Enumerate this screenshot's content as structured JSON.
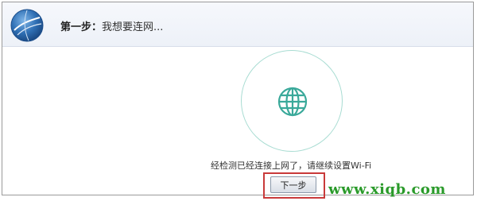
{
  "header": {
    "step_label": "第一步：",
    "step_text": "我想要连网..."
  },
  "status": {
    "message": "经检测已经连接上网了，请继续设置Wi-Fi"
  },
  "actions": {
    "next_label": "下一步"
  },
  "watermark": {
    "text": "www.xiqb.com"
  },
  "colors": {
    "ring": "#a8dcd2",
    "globe": "#3aa99a",
    "highlight": "#c93a3a",
    "watermark": "#2a9a2a"
  },
  "icons": {
    "logo": "app-logo-icon",
    "network": "globe-icon"
  }
}
